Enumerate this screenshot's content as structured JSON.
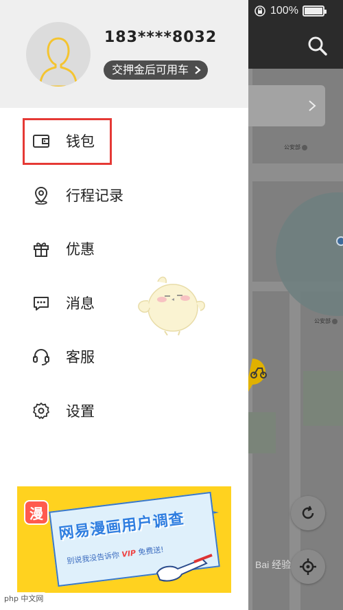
{
  "status_bar": {
    "battery": "100%",
    "battery_level": 1.0
  },
  "profile": {
    "phone": "183****8032",
    "deposit_prompt": "交押金后可用车"
  },
  "menu": [
    {
      "id": "wallet",
      "label": "钱包",
      "icon": "wallet-icon",
      "highlighted": true
    },
    {
      "id": "trip-history",
      "label": "行程记录",
      "icon": "location-pin-icon"
    },
    {
      "id": "offers",
      "label": "优惠",
      "icon": "gift-icon"
    },
    {
      "id": "messages",
      "label": "消息",
      "icon": "message-icon"
    },
    {
      "id": "customer-service",
      "label": "客服",
      "icon": "headset-icon"
    },
    {
      "id": "settings",
      "label": "设置",
      "icon": "gear-icon"
    }
  ],
  "banner": {
    "logo_char": "漫",
    "title": "网易漫画用户调查",
    "subtitle_prefix": "别说我没告诉你",
    "subtitle_highlight": "VIP",
    "subtitle_suffix": "免费送!"
  },
  "map": {
    "poi_1": "公安部",
    "poi_2": "公安部",
    "attribution": "Bai 经验"
  },
  "watermark": "php 中文网",
  "colors": {
    "accent_red": "#e53935",
    "banner_yellow": "#ffd21f",
    "avatar_outline": "#f4c430"
  }
}
